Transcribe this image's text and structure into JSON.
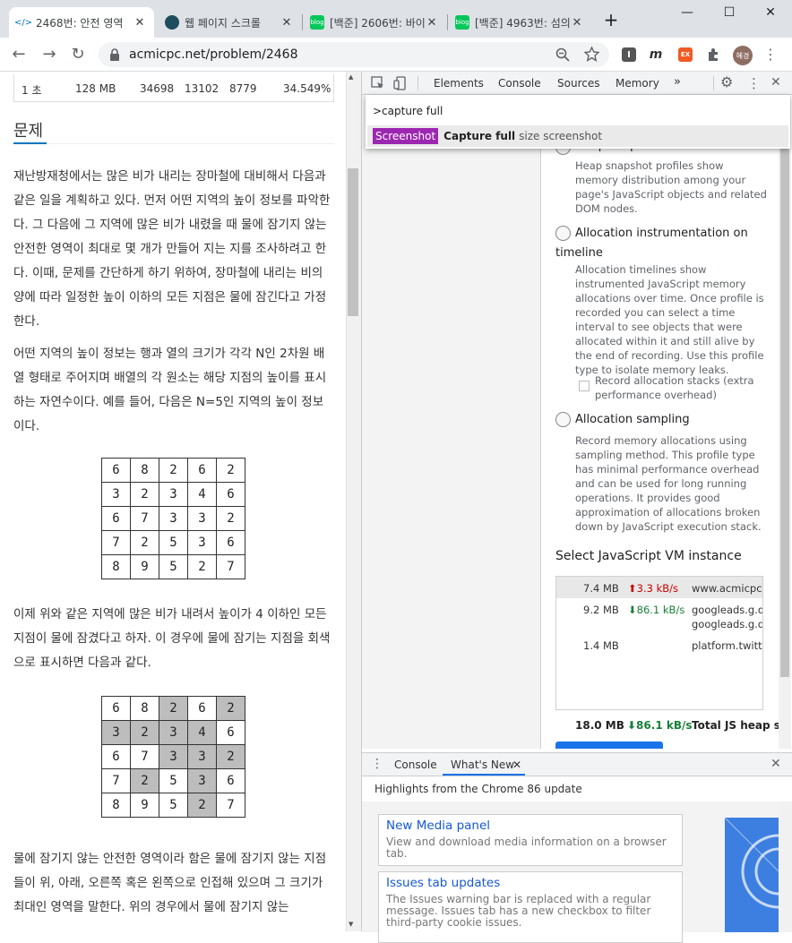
{
  "browser": {
    "tabs": [
      {
        "title": "2468번: 안전 영역",
        "close": "✕"
      },
      {
        "title": "웹 페이지 스크롤",
        "close": "✕"
      },
      {
        "title": "[백준] 2606번: 바이",
        "close": "✕"
      },
      {
        "title": "[백준] 4963번: 섬의",
        "close": "✕"
      }
    ],
    "new_tab": "+",
    "window": {
      "minimize": "—",
      "maximize": "☐",
      "close": "✕"
    },
    "url": "acmicpc.net/problem/2468",
    "avatar": "혜경",
    "ext_labels": {
      "instapaper": "I",
      "m": "m",
      "ex": "EX"
    }
  },
  "page": {
    "limits": {
      "time": "1 초",
      "memory": "128 MB",
      "submissions": "34698",
      "accepted": "13102",
      "solvers": "8779",
      "ratio": "34.549%"
    },
    "section_title": "문제",
    "para1": "재난방재청에서는 많은 비가 내리는 장마철에 대비해서 다음과 같은 일을 계획하고 있다. 먼저 어떤 지역의 높이 정보를 파악한다. 그 다음에 그 지역에 많은 비가 내렸을 때 물에 잠기지 않는 안전한 영역이 최대로 몇 개가 만들어 지는 지를 조사하려고 한다. 이때, 문제를 간단하게 하기 위하여, 장마철에 내리는 비의 양에 따라 일정한 높이 이하의 모든 지점은 물에 잠긴다고 가정한다.",
    "para2": "어떤 지역의 높이 정보는 행과 열의 크기가 각각 N인 2차원 배열 형태로 주어지며 배열의 각 원소는 해당 지점의 높이를 표시하는 자연수이다. 예를 들어, 다음은 N=5인 지역의 높이 정보이다.",
    "grid1": [
      [
        6,
        8,
        2,
        6,
        2
      ],
      [
        3,
        2,
        3,
        4,
        6
      ],
      [
        6,
        7,
        3,
        3,
        2
      ],
      [
        7,
        2,
        5,
        3,
        6
      ],
      [
        8,
        9,
        5,
        2,
        7
      ]
    ],
    "para3": "이제 위와 같은 지역에 많은 비가 내려서 높이가 4 이하인 모든 지점이 물에 잠겼다고 하자. 이 경우에 물에 잠기는 지점을 회색으로 표시하면 다음과 같다.",
    "grid2": [
      [
        6,
        8,
        2,
        6,
        2
      ],
      [
        3,
        2,
        3,
        4,
        6
      ],
      [
        6,
        7,
        3,
        3,
        2
      ],
      [
        7,
        2,
        5,
        3,
        6
      ],
      [
        8,
        9,
        5,
        2,
        7
      ]
    ],
    "grid2_flooded": [
      [
        false,
        false,
        true,
        false,
        true
      ],
      [
        true,
        true,
        true,
        true,
        false
      ],
      [
        false,
        false,
        true,
        true,
        true
      ],
      [
        false,
        true,
        false,
        true,
        false
      ],
      [
        false,
        false,
        false,
        true,
        false
      ]
    ],
    "para4": "물에 잠기지 않는 안전한 영역이라 함은 물에 잠기지 않는 지점들이 위, 아래, 오른쪽 혹은 왼쪽으로 인접해 있으며 그 크기가 최대인 영역을 말한다. 위의 경우에서 물에 잠기지 않는"
  },
  "devtools": {
    "tabs": [
      "Elements",
      "Console",
      "Sources",
      "Memory",
      "»"
    ],
    "command_input": ">capture full",
    "command_result": {
      "tag": "Screenshot",
      "main": "Capture full",
      "sub": "size screenshot"
    },
    "heap_snapshot_title": "Heap snapshot",
    "heap_snapshot_desc": "Heap snapshot profiles show memory distribution among your page's JavaScript objects and related DOM nodes.",
    "alloc_timeline_title": "Allocation instrumentation on timeline",
    "alloc_timeline_desc": "Allocation timelines show instrumented JavaScript memory allocations over time. Once profile is recorded you can select a time interval to see objects that were allocated within it and still alive by the end of recording. Use this profile type to isolate memory leaks.",
    "record_stacks": "Record allocation stacks (extra performance overhead)",
    "alloc_sampling_title": "Allocation sampling",
    "alloc_sampling_desc": "Record memory allocations using sampling method. This profile type has minimal performance overhead and can be used for long running operations. It provides good approximation of allocations broken down by JavaScript execution stack.",
    "vm_heading": "Select JavaScript VM instance",
    "vm_rows": [
      {
        "size": "7.4 MB",
        "rate": "⬆3.3 kB/s",
        "host": "www.acmicpc.net"
      },
      {
        "size": "9.2 MB",
        "rate": "⬇86.1 kB/s",
        "host": "googleads.g.doubleclick.net",
        "host2": "googleads.g.doubleclick.net"
      },
      {
        "size": "1.4 MB",
        "rate": "",
        "host": "platform.twitter.com"
      }
    ],
    "vm_total": {
      "size": "18.0 MB",
      "rate": "⬇86.1 kB/s",
      "label": "Total JS heap size"
    },
    "drawer": {
      "tabs": [
        "Console",
        "What's New"
      ],
      "tab_close": "✕",
      "close": "✕",
      "highlight": "Highlights from the Chrome 86 update",
      "cards": [
        {
          "title": "New Media panel",
          "desc": "View and download media information on a browser tab."
        },
        {
          "title": "Issues tab updates",
          "desc": "The Issues warning bar is replaced with a regular message. Issues tab has a new checkbox to filter third-party cookie issues."
        }
      ]
    }
  }
}
